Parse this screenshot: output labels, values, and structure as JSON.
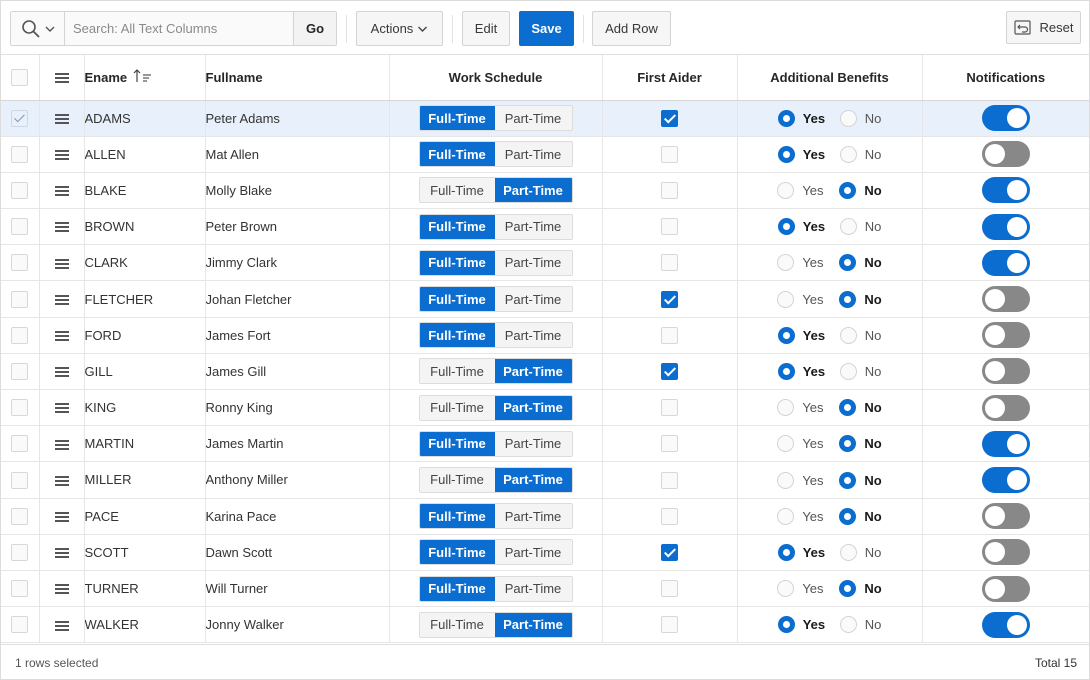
{
  "toolbar": {
    "search_placeholder": "Search: All Text Columns",
    "go_label": "Go",
    "actions_label": "Actions",
    "edit_label": "Edit",
    "save_label": "Save",
    "add_row_label": "Add Row",
    "reset_label": "Reset"
  },
  "columns": {
    "ename": "Ename",
    "fullname": "Fullname",
    "work_schedule": "Work Schedule",
    "first_aider": "First Aider",
    "additional_benefits": "Additional Benefits",
    "notifications": "Notifications"
  },
  "schedule_options": {
    "full": "Full-Time",
    "part": "Part-Time"
  },
  "benefit_options": {
    "yes": "Yes",
    "no": "No"
  },
  "colors": {
    "accent": "#0b6dd0",
    "selected_row": "#e8f1fb",
    "switch_off": "#888888"
  },
  "rows": [
    {
      "ename": "ADAMS",
      "fullname": "Peter Adams",
      "schedule": "full",
      "first_aider": true,
      "benefits": "yes",
      "notifications": true,
      "selected": true
    },
    {
      "ename": "ALLEN",
      "fullname": "Mat Allen",
      "schedule": "full",
      "first_aider": false,
      "benefits": "yes",
      "notifications": false,
      "selected": false
    },
    {
      "ename": "BLAKE",
      "fullname": "Molly Blake",
      "schedule": "part",
      "first_aider": false,
      "benefits": "no",
      "notifications": true,
      "selected": false
    },
    {
      "ename": "BROWN",
      "fullname": "Peter Brown",
      "schedule": "full",
      "first_aider": false,
      "benefits": "yes",
      "notifications": true,
      "selected": false
    },
    {
      "ename": "CLARK",
      "fullname": "Jimmy Clark",
      "schedule": "full",
      "first_aider": false,
      "benefits": "no",
      "notifications": true,
      "selected": false
    },
    {
      "ename": "FLETCHER",
      "fullname": "Johan Fletcher",
      "schedule": "full",
      "first_aider": true,
      "benefits": "no",
      "notifications": false,
      "selected": false
    },
    {
      "ename": "FORD",
      "fullname": "James Fort",
      "schedule": "full",
      "first_aider": false,
      "benefits": "yes",
      "notifications": false,
      "selected": false
    },
    {
      "ename": "GILL",
      "fullname": "James Gill",
      "schedule": "part",
      "first_aider": true,
      "benefits": "yes",
      "notifications": false,
      "selected": false
    },
    {
      "ename": "KING",
      "fullname": "Ronny King",
      "schedule": "part",
      "first_aider": false,
      "benefits": "no",
      "notifications": false,
      "selected": false
    },
    {
      "ename": "MARTIN",
      "fullname": "James Martin",
      "schedule": "full",
      "first_aider": false,
      "benefits": "no",
      "notifications": true,
      "selected": false
    },
    {
      "ename": "MILLER",
      "fullname": "Anthony Miller",
      "schedule": "part",
      "first_aider": false,
      "benefits": "no",
      "notifications": true,
      "selected": false
    },
    {
      "ename": "PACE",
      "fullname": "Karina Pace",
      "schedule": "full",
      "first_aider": false,
      "benefits": "no",
      "notifications": false,
      "selected": false
    },
    {
      "ename": "SCOTT",
      "fullname": "Dawn Scott",
      "schedule": "full",
      "first_aider": true,
      "benefits": "yes",
      "notifications": false,
      "selected": false
    },
    {
      "ename": "TURNER",
      "fullname": "Will Turner",
      "schedule": "full",
      "first_aider": false,
      "benefits": "no",
      "notifications": false,
      "selected": false
    },
    {
      "ename": "WALKER",
      "fullname": "Jonny Walker",
      "schedule": "part",
      "first_aider": false,
      "benefits": "yes",
      "notifications": true,
      "selected": false
    }
  ],
  "footer": {
    "selection_text": "1 rows selected",
    "total_text": "Total 15"
  }
}
